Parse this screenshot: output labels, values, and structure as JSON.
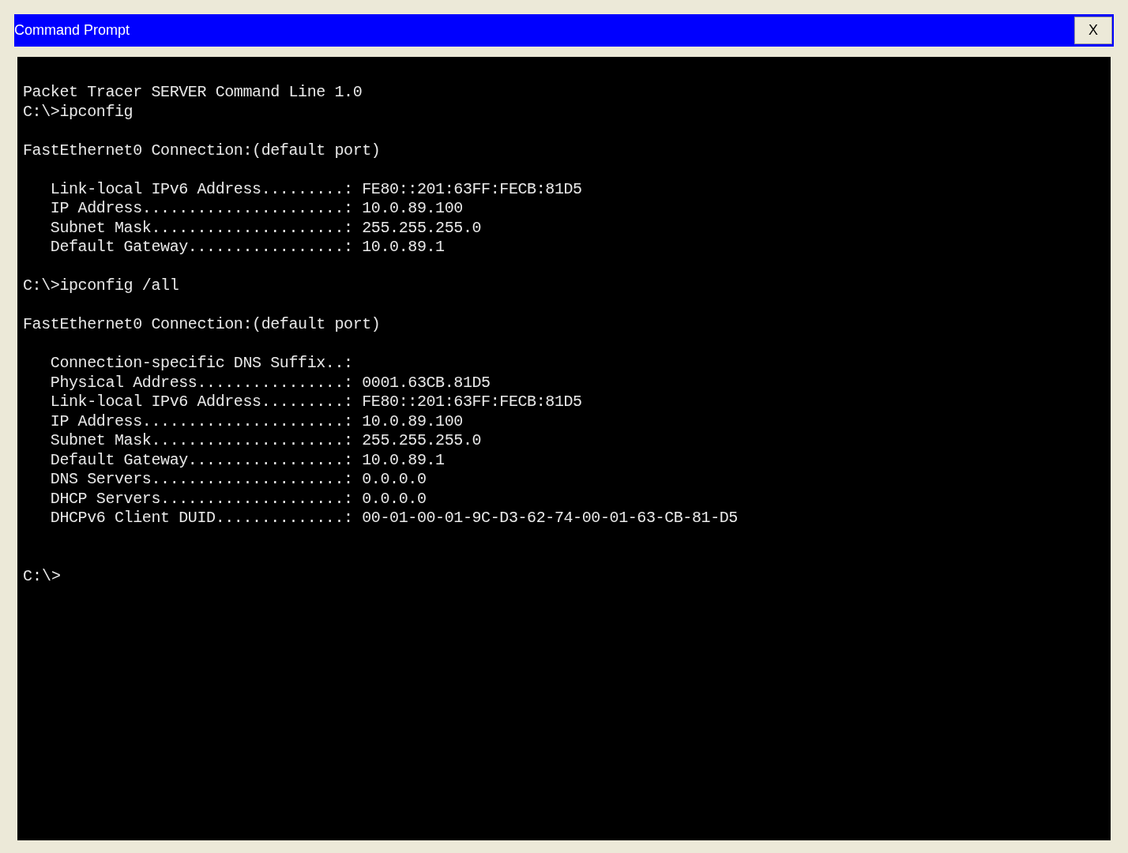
{
  "window": {
    "title": "Command Prompt",
    "close_button": "X"
  },
  "terminal": {
    "blocks": [
      [
        "Packet Tracer SERVER Command Line 1.0",
        "C:\\>ipconfig"
      ],
      [
        "FastEthernet0 Connection:(default port)"
      ],
      [
        "   Link-local IPv6 Address.........: FE80::201:63FF:FECB:81D5",
        "   IP Address......................: 10.0.89.100",
        "   Subnet Mask.....................: 255.255.255.0",
        "   Default Gateway.................: 10.0.89.1"
      ],
      [
        "C:\\>ipconfig /all"
      ],
      [
        "FastEthernet0 Connection:(default port)"
      ],
      [
        "   Connection-specific DNS Suffix..:",
        "   Physical Address................: 0001.63CB.81D5",
        "   Link-local IPv6 Address.........: FE80::201:63FF:FECB:81D5",
        "   IP Address......................: 10.0.89.100",
        "   Subnet Mask.....................: 255.255.255.0",
        "   Default Gateway.................: 10.0.89.1",
        "   DNS Servers.....................: 0.0.0.0",
        "   DHCP Servers....................: 0.0.0.0",
        "   DHCPv6 Client DUID..............: 00-01-00-01-9C-D3-62-74-00-01-63-CB-81-D5"
      ]
    ],
    "prompt": "C:\\>"
  }
}
